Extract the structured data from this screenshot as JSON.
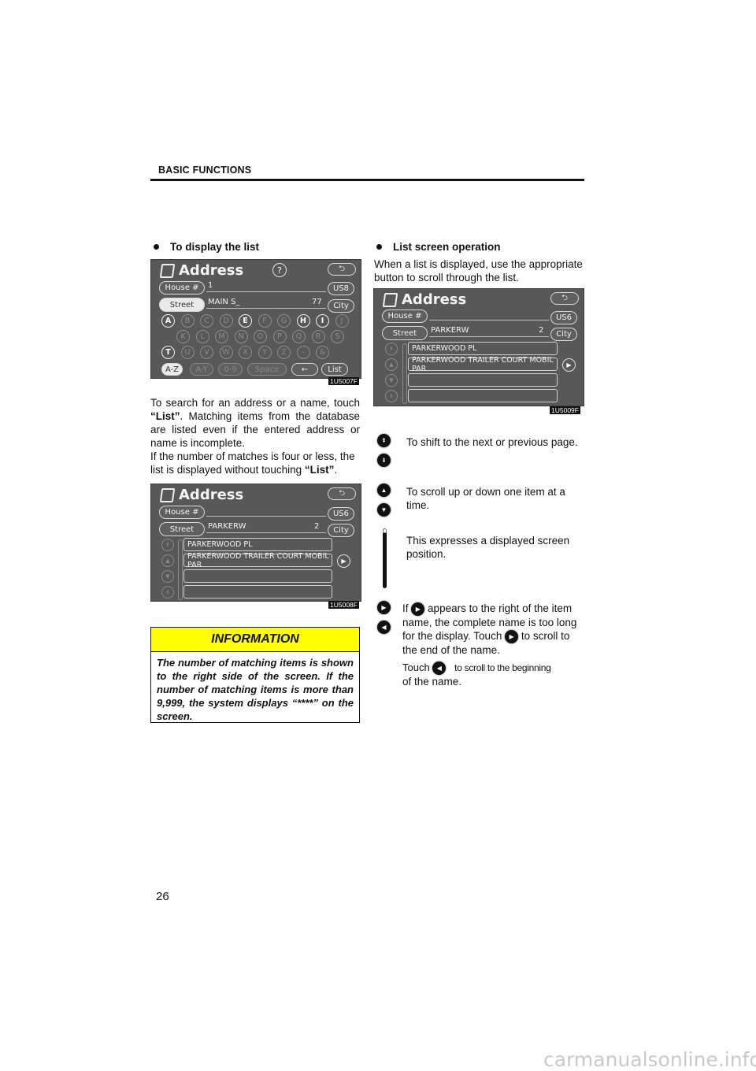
{
  "header": {
    "section_title": "BASIC FUNCTIONS"
  },
  "left_column": {
    "heading": "To display the list",
    "screen1": {
      "title": "Address",
      "help_label": "?",
      "back_label": "⮌",
      "house_label": "House #",
      "house_value": "1",
      "street_label": "Street",
      "street_value": "MAIN S_",
      "match_count": "77",
      "state_label": "US8",
      "city_label": "City",
      "keys_row1": [
        {
          "k": "A",
          "on": true
        },
        {
          "k": "B",
          "on": false
        },
        {
          "k": "C",
          "on": false
        },
        {
          "k": "D",
          "on": false
        },
        {
          "k": "E",
          "on": true
        },
        {
          "k": "F",
          "on": false
        },
        {
          "k": "G",
          "on": false
        },
        {
          "k": "H",
          "on": true
        },
        {
          "k": "I",
          "on": true
        },
        {
          "k": "J",
          "on": false
        }
      ],
      "keys_row2": [
        {
          "k": "K",
          "on": false
        },
        {
          "k": "L",
          "on": false
        },
        {
          "k": "M",
          "on": false
        },
        {
          "k": "N",
          "on": false
        },
        {
          "k": "O",
          "on": false
        },
        {
          "k": "P",
          "on": false
        },
        {
          "k": "Q",
          "on": false
        },
        {
          "k": "R",
          "on": false
        },
        {
          "k": "S",
          "on": false
        }
      ],
      "keys_row3": [
        {
          "k": "T",
          "on": true
        },
        {
          "k": "U",
          "on": false
        },
        {
          "k": "V",
          "on": false
        },
        {
          "k": "W",
          "on": false
        },
        {
          "k": "X",
          "on": false
        },
        {
          "k": "Y",
          "on": false
        },
        {
          "k": "Z",
          "on": false
        },
        {
          "k": "-",
          "on": false
        },
        {
          "k": "&",
          "on": false
        }
      ],
      "btn_az": "A-Z",
      "btn_ay": "A-Y",
      "btn_09": "0-9",
      "btn_space": "Space",
      "btn_backspace": "←",
      "btn_list": "List",
      "image_code": "1U5007F"
    },
    "para1_pre": "To search for an address or a name, touch ",
    "para1_bold": "“List”",
    "para1_post": ".  Matching items from the database are listed even if the entered address or name is incomplete.",
    "para2_pre": "If the number of matches is four or less, the list is displayed without touching ",
    "para2_bold": "“List”",
    "para2_post": ".",
    "screen2": {
      "title": "Address",
      "back_label": "⮌",
      "house_label": "House #",
      "street_label": "Street",
      "street_value": "PARKERW",
      "match_count": "2",
      "state_label": "US6",
      "city_label": "City",
      "rows": [
        "PARKERWOOD PL",
        "PARKERWOOD TRAILER COURT MOBIL PAR",
        "",
        ""
      ],
      "image_code": "1U5008F"
    },
    "info": {
      "title": "INFORMATION",
      "body": "The number of matching items is shown to the right side of the screen. If the number of matching items is more than 9,999, the system displays “****” on the screen."
    }
  },
  "right_column": {
    "heading": "List screen operation",
    "intro": "When a list is displayed, use the appropriate button to scroll through the list.",
    "screen3": {
      "title": "Address",
      "back_label": "⮌",
      "house_label": "House #",
      "street_label": "Street",
      "street_value": "PARKERW",
      "match_count": "2",
      "state_label": "US6",
      "city_label": "City",
      "rows": [
        "PARKERWOOD PL",
        "PARKERWOOD TRAILER COURT MOBIL PAR",
        "",
        ""
      ],
      "image_code": "1U5009F"
    },
    "legend": {
      "page_shift": "To shift to the next or previous page.",
      "item_scroll": "To scroll up or down one item at a time.",
      "position_bar": "This expresses a displayed screen position.",
      "name_scroll_1": "If",
      "name_scroll_2": "appears to the right of the item name, the complete name is too long for the display.  Touch",
      "name_scroll_3": "to scroll to the end of the name.",
      "name_scroll_4_pre": "Touch",
      "name_scroll_4_post": "to scroll to the beginning",
      "name_scroll_5": "of the name."
    }
  },
  "footer": {
    "page_number": "26",
    "watermark": "carmanualsonline.info"
  }
}
